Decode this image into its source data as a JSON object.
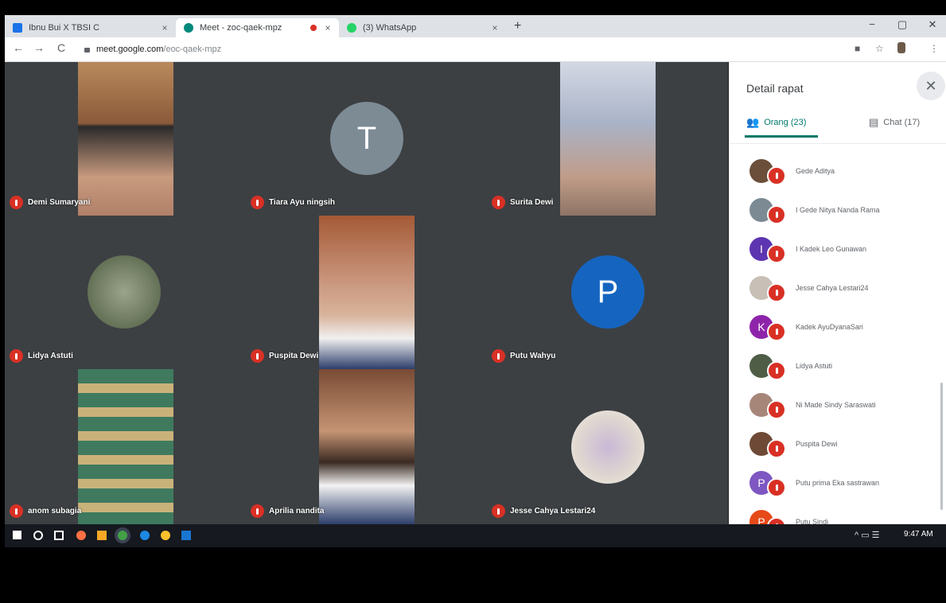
{
  "browser": {
    "tabs": [
      {
        "title": "Ibnu Bui X TBSI C",
        "favicon_color": "#1a73e8",
        "close": "×"
      },
      {
        "title": "Meet - zoc-qaek-mpz",
        "favicon_color": "#00897b",
        "close": "×"
      },
      {
        "title": "(3) WhatsApp",
        "favicon_color": "#25d366",
        "close": "×"
      }
    ],
    "new_tab": "+",
    "window_controls": {
      "minimize": "−",
      "maximize": "▢",
      "close": "✕"
    },
    "nav": {
      "back": "←",
      "forward": "→",
      "reload": "C"
    },
    "url_host": "meet.google.com",
    "url_path": "/eoc-qaek-mpz"
  },
  "meet": {
    "tiles": [
      {
        "name": "Demi Sumaryani",
        "kind": "camera",
        "bg": "#8a5a3a",
        "face": "#c89a7e"
      },
      {
        "name": "Tiara Ayu ningsih",
        "kind": "avatar",
        "initial": "T",
        "avatar_color": "#7d8b95"
      },
      {
        "name": "Surita Dewi",
        "kind": "camera",
        "bg": "#a9b3c7",
        "face": "#c09c88"
      },
      {
        "name": "Lidya Astuti",
        "kind": "circle",
        "circle_bg": "#6a7a58"
      },
      {
        "name": "Puspita Dewi",
        "kind": "camera",
        "bg": "#a45a36",
        "face": "#c79278"
      },
      {
        "name": "Putu Wahyu",
        "kind": "avatar",
        "initial": "P",
        "avatar_color": "#1565c0"
      },
      {
        "name": "anom subagia",
        "kind": "camera",
        "bg": "#5c8f76",
        "face": "#c9b27a"
      },
      {
        "name": "Aprilia nandita",
        "kind": "camera",
        "bg": "#7a4b34",
        "face": "#c59474"
      },
      {
        "name": "Jesse Cahya Lestari24",
        "kind": "circle",
        "circle_bg": "#e0d8d0"
      }
    ]
  },
  "panel": {
    "title": "Detail rapat",
    "close": "✕",
    "tab_people": "Orang (23)",
    "tab_chat": "Chat (17)",
    "people_icon": "people-icon",
    "chat_icon": "chat-icon",
    "participants": [
      {
        "name": "Gede Aditya",
        "initial": "",
        "color": "#6b4f3a"
      },
      {
        "name": "I Gede Nitya Nanda Rama",
        "initial": "",
        "color": "#7b8a93"
      },
      {
        "name": "I Kadek Leo Gunawan",
        "initial": "I",
        "color": "#5e35b1"
      },
      {
        "name": "Jesse Cahya Lestari24",
        "initial": "",
        "color": "#c8bfb6"
      },
      {
        "name": "Kadek AyuDyanaSari",
        "initial": "K",
        "color": "#8e24aa"
      },
      {
        "name": "Lidya Astuti",
        "initial": "",
        "color": "#4f5d46"
      },
      {
        "name": "Ni Made Sindy Saraswati",
        "initial": "",
        "color": "#a7867a"
      },
      {
        "name": "Puspita Dewi",
        "initial": "",
        "color": "#6e4a36"
      },
      {
        "name": "Putu prima Eka sastrawan",
        "initial": "P",
        "color": "#7e57c2"
      },
      {
        "name": "Putu Sindi",
        "initial": "P",
        "color": "#e64a19"
      }
    ]
  },
  "taskbar": {
    "clock": "9:47 AM",
    "tray": "^ ▭ ☰"
  }
}
